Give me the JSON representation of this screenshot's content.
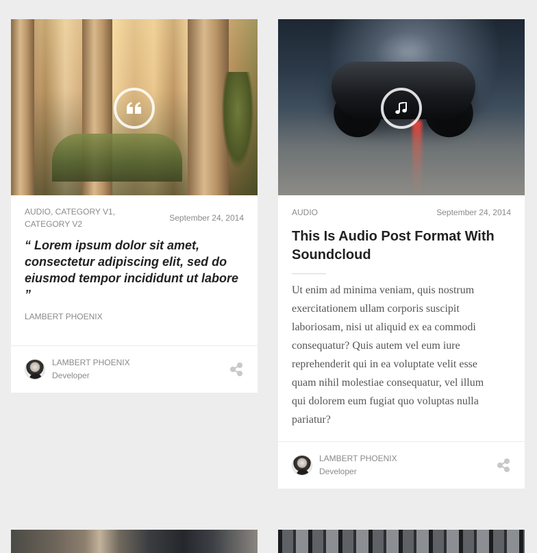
{
  "cards": [
    {
      "format": "quote",
      "format_icon": "quote-icon",
      "categories": "AUDIO, CATEGORY V1, CATEGORY V2",
      "categories_line1": "AUDIO, CATEGORY V1,",
      "categories_line2": "CATEGORY V2",
      "date": "September 24, 2014",
      "quote_line1": "“ Lorem ipsum dolor sit amet,",
      "quote_line2": "consectetur adipiscing elit, sed do",
      "quote_line3": "eiusmod tempor incididunt ut labore",
      "quote_line4": "”",
      "quote_author": "LAMBERT PHOENIX",
      "author": {
        "name": "LAMBERT PHOENIX",
        "role": "Developer"
      }
    },
    {
      "format": "audio",
      "format_icon": "music-note-icon",
      "categories": "AUDIO",
      "date": "September 24, 2014",
      "title_line1": "This Is Audio Post Format With",
      "title_line2": "Soundcloud",
      "excerpt_lines": [
        "Ut enim ad minima veniam, quis nostrum",
        "exercitationem ullam corporis suscipit",
        "laboriosam, nisi ut aliquid ex ea commodi",
        "consequatur? Quis autem vel eum iure",
        "reprehenderit qui in ea voluptate velit esse",
        "quam nihil molestiae consequatur, vel illum",
        "qui dolorem eum fugiat quo voluptas nulla",
        "pariatur?"
      ],
      "author": {
        "name": "LAMBERT PHOENIX",
        "role": "Developer"
      }
    }
  ],
  "colors": {
    "page_background": "#ededed",
    "card_background": "#ffffff",
    "meta_text": "#8a8a8a",
    "title_text": "#222222",
    "share_icon": "#c8c8c8"
  }
}
